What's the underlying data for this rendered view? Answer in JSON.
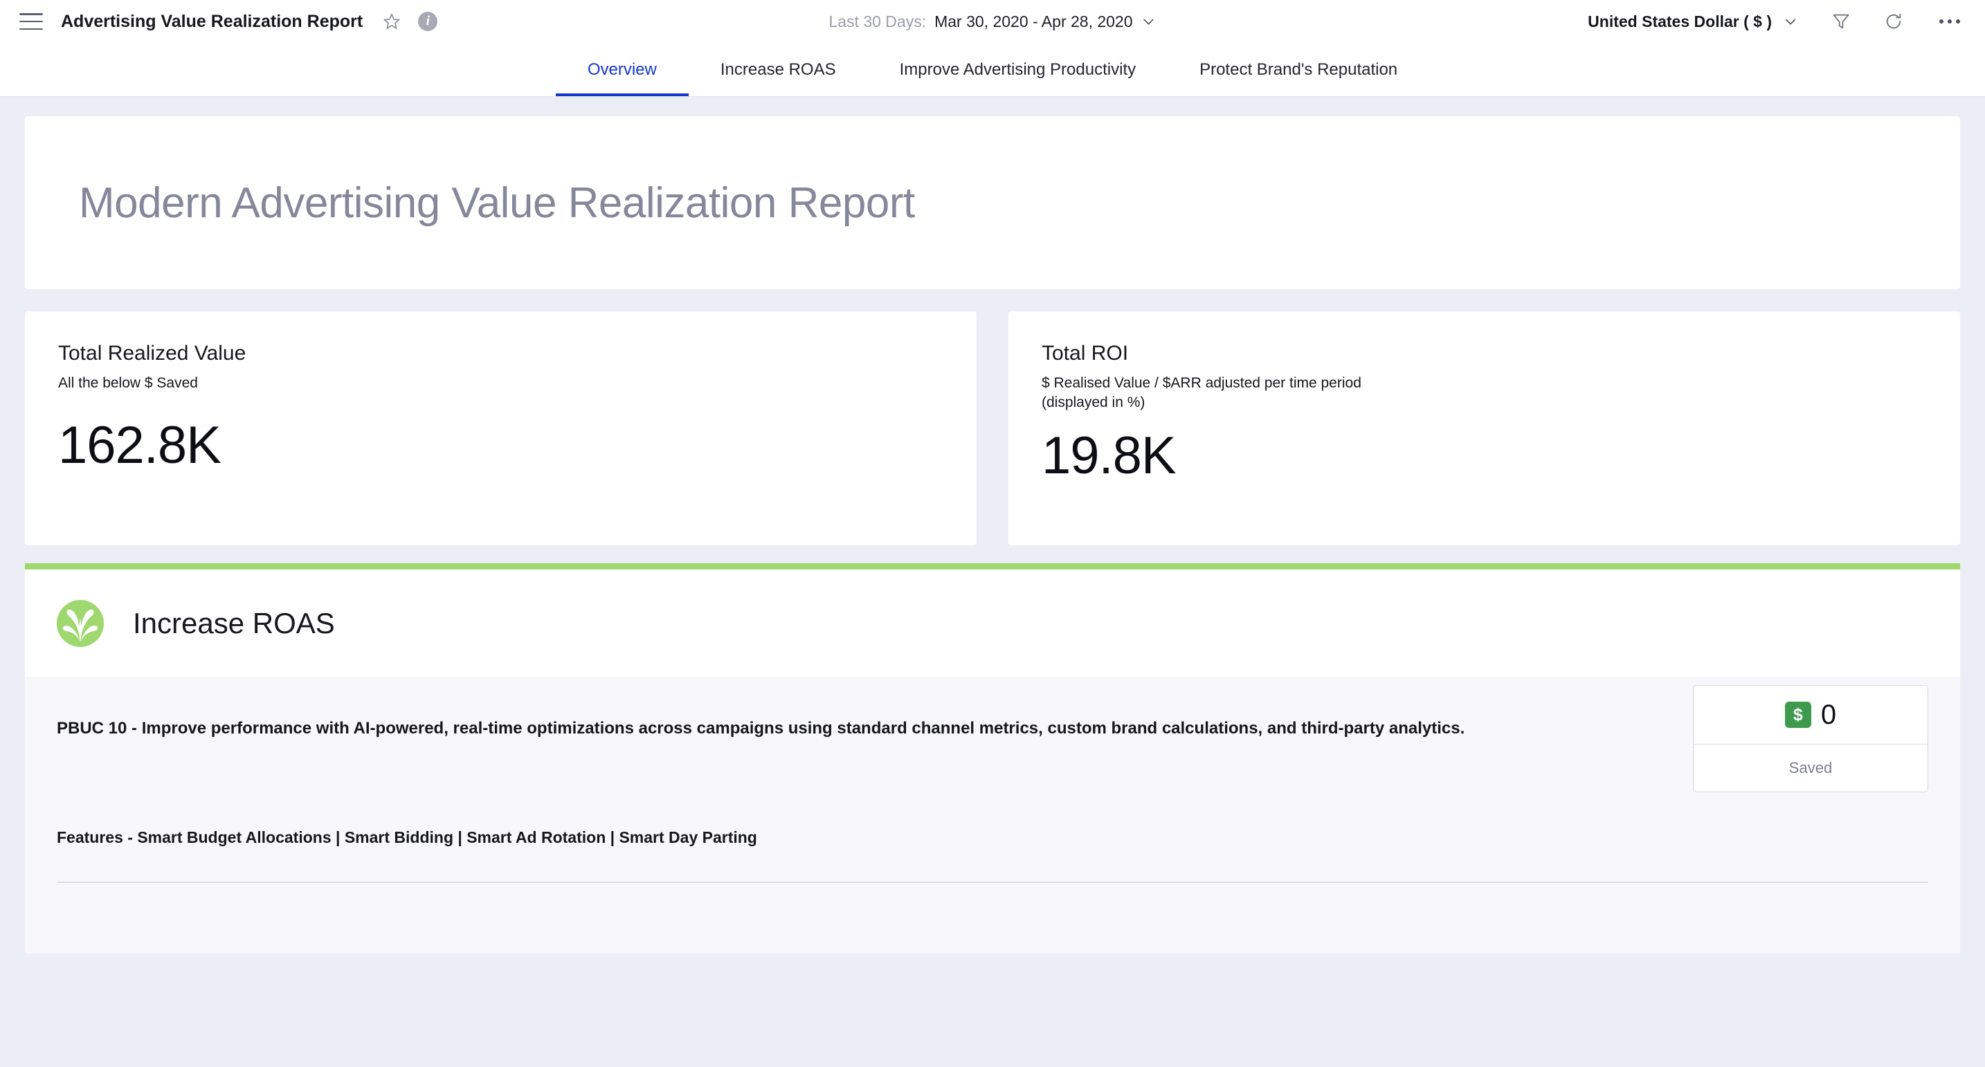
{
  "header": {
    "menu_icon": "hamburger-icon",
    "app_title": "Advertising Value Realization Report",
    "star_icon": "star-icon",
    "info_icon": "info-icon",
    "date_range_label": "Last 30 Days:",
    "date_range_value": "Mar 30, 2020 - Apr 28, 2020",
    "date_chevron_icon": "chevron-down-icon",
    "currency": "United States Dollar ( $ )",
    "currency_chevron_icon": "chevron-down-icon",
    "filter_icon": "filter-icon",
    "refresh_icon": "refresh-icon",
    "more_icon": "more-horizontal-icon"
  },
  "tabs": [
    {
      "label": "Overview",
      "active": true
    },
    {
      "label": "Increase ROAS",
      "active": false
    },
    {
      "label": "Improve Advertising Productivity",
      "active": false
    },
    {
      "label": "Protect Brand's Reputation",
      "active": false
    }
  ],
  "report": {
    "title": "Modern Advertising Value Realization Report"
  },
  "kpis": [
    {
      "title": "Total Realized Value",
      "subtitle": "All the below $ Saved",
      "value": "162.8K"
    },
    {
      "title": "Total ROI",
      "subtitle": "$ Realised Value / $ARR adjusted per time period (displayed in %)",
      "value": "19.8K"
    }
  ],
  "section": {
    "accent_color": "#9fd86e",
    "logo_icon": "leaf-sprout-logo-icon",
    "title": "Increase ROAS",
    "description": "PBUC 10 - Improve performance with AI-powered, real-time optimizations across campaigns using standard channel metrics, custom brand calculations, and third-party analytics.",
    "features": "Features - Smart Budget Allocations | Smart Bidding | Smart Ad Rotation | Smart Day Parting",
    "saved_card": {
      "badge_icon": "dollar-badge-icon",
      "badge_symbol": "$",
      "badge_color": "#3f9a4d",
      "value": "0",
      "label": "Saved"
    }
  },
  "colors": {
    "accent_blue": "#1536cc",
    "accent_green": "#9fd86e",
    "badge_green": "#3f9a4d",
    "page_bg": "#eceef6"
  }
}
